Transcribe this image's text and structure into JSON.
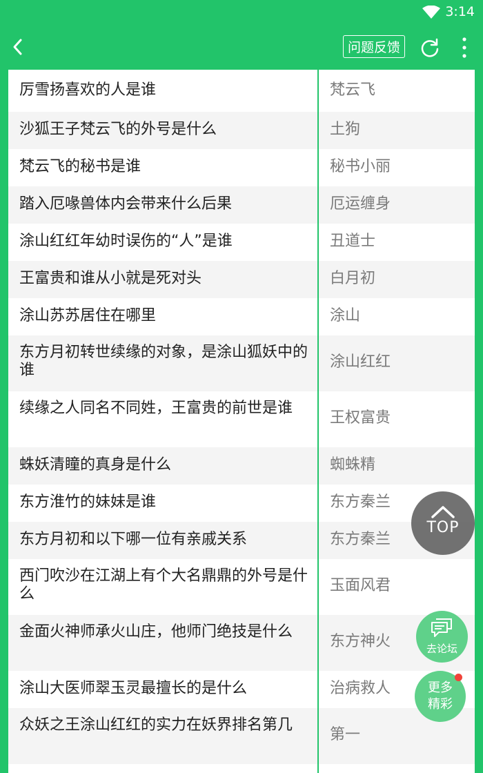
{
  "status": {
    "time": "3:14"
  },
  "toolbar": {
    "feedback_label": "问题反馈"
  },
  "rows": [
    {
      "q": "厉雪扬喜欢的人是谁",
      "a": "梵云飞"
    },
    {
      "q": "沙狐王子梵云飞的外号是什么",
      "a": "土狗"
    },
    {
      "q": "梵云飞的秘书是谁",
      "a": "秘书小丽"
    },
    {
      "q": "踏入厄喙兽体内会带来什么后果",
      "a": "厄运缠身"
    },
    {
      "q": "涂山红红年幼时误伤的“人”是谁",
      "a": "丑道士"
    },
    {
      "q": "王富贵和谁从小就是死对头",
      "a": "白月初"
    },
    {
      "q": "涂山苏苏居住在哪里",
      "a": "涂山"
    },
    {
      "q": "东方月初转世续缘的对象，是涂山狐妖中的谁",
      "a": "涂山红红"
    },
    {
      "q": "续缘之人同名不同姓，王富贵的前世是谁",
      "a": "王权富贵"
    },
    {
      "q": "蛛妖清瞳的真身是什么",
      "a": "蜘蛛精"
    },
    {
      "q": "东方淮竹的妹妹是谁",
      "a": "东方秦兰"
    },
    {
      "q": "东方月初和以下哪一位有亲戚关系",
      "a": "东方秦兰"
    },
    {
      "q": "西门吹沙在江湖上有个大名鼎鼎的外号是什么",
      "a": "玉面风君"
    },
    {
      "q": "金面火神师承火山庄，他师门绝技是什么",
      "a": "东方神火"
    },
    {
      "q": "涂山大医师翠玉灵最擅长的是什么",
      "a": "治病救人"
    },
    {
      "q": "众妖之王涂山红红的实力在妖界排名第几",
      "a": "第一"
    }
  ],
  "floating": {
    "top_label": "TOP",
    "forum_label": "去论坛",
    "more_line1": "更多",
    "more_line2": "精彩"
  },
  "colors": {
    "brand": "#22c46a",
    "alt_row": "#f4f4f4",
    "badge": "#f0443a"
  },
  "icons": [
    "wifi-icon",
    "back-arrow-icon",
    "refresh-icon",
    "more-vert-icon",
    "chevron-up-icon",
    "chat-bubble-icon"
  ]
}
